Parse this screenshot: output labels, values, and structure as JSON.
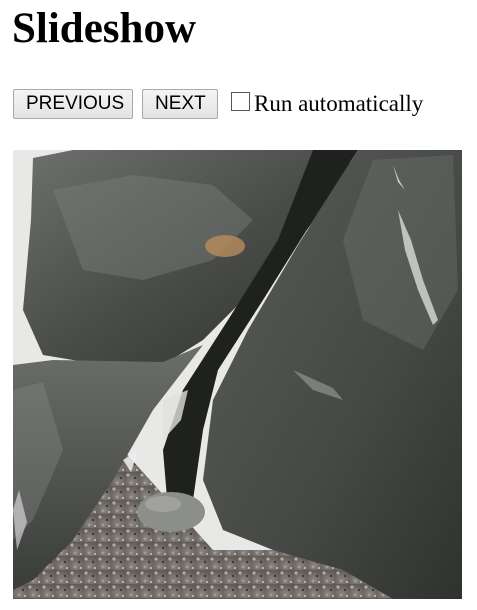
{
  "page": {
    "title": "Slideshow"
  },
  "controls": {
    "previous_label": "PREVIOUS",
    "next_label": "NEXT",
    "auto_label": "Run automatically",
    "auto_checked": false
  },
  "slide": {
    "alt": "Photo of large dark rocks on a pebble beach"
  },
  "colors": {
    "background": "#ffffff",
    "button_face": "#e9e9e9",
    "button_border": "#a9a9a9"
  }
}
